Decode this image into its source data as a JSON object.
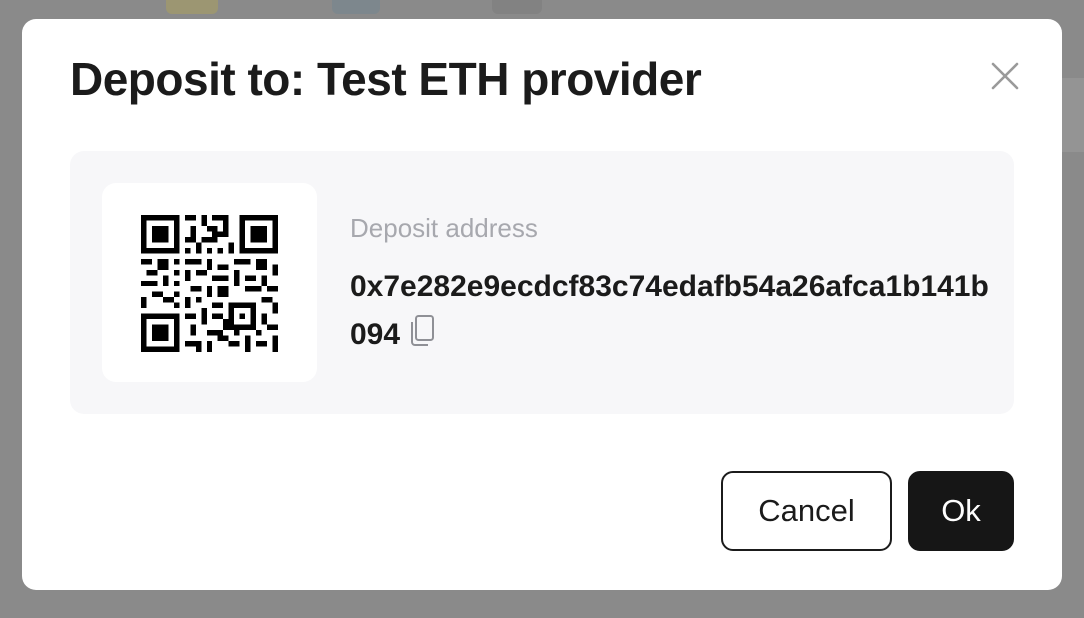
{
  "dialog": {
    "title": "Deposit to: Test ETH provider",
    "close_icon": "close-icon"
  },
  "deposit": {
    "label": "Deposit address",
    "address": "0x7e282e9ecdcf83c74edafb54a26afca1b141b094",
    "copy_icon": "copy-icon",
    "qr_icon": "qr-code"
  },
  "actions": {
    "cancel_label": "Cancel",
    "ok_label": "Ok"
  },
  "colors": {
    "overlay": "#8a8a8a",
    "modal_bg": "#ffffff",
    "panel_bg": "#f7f7f9",
    "text": "#1b1b1b",
    "muted_text": "#a7a8ae",
    "primary_button": "#161616"
  }
}
